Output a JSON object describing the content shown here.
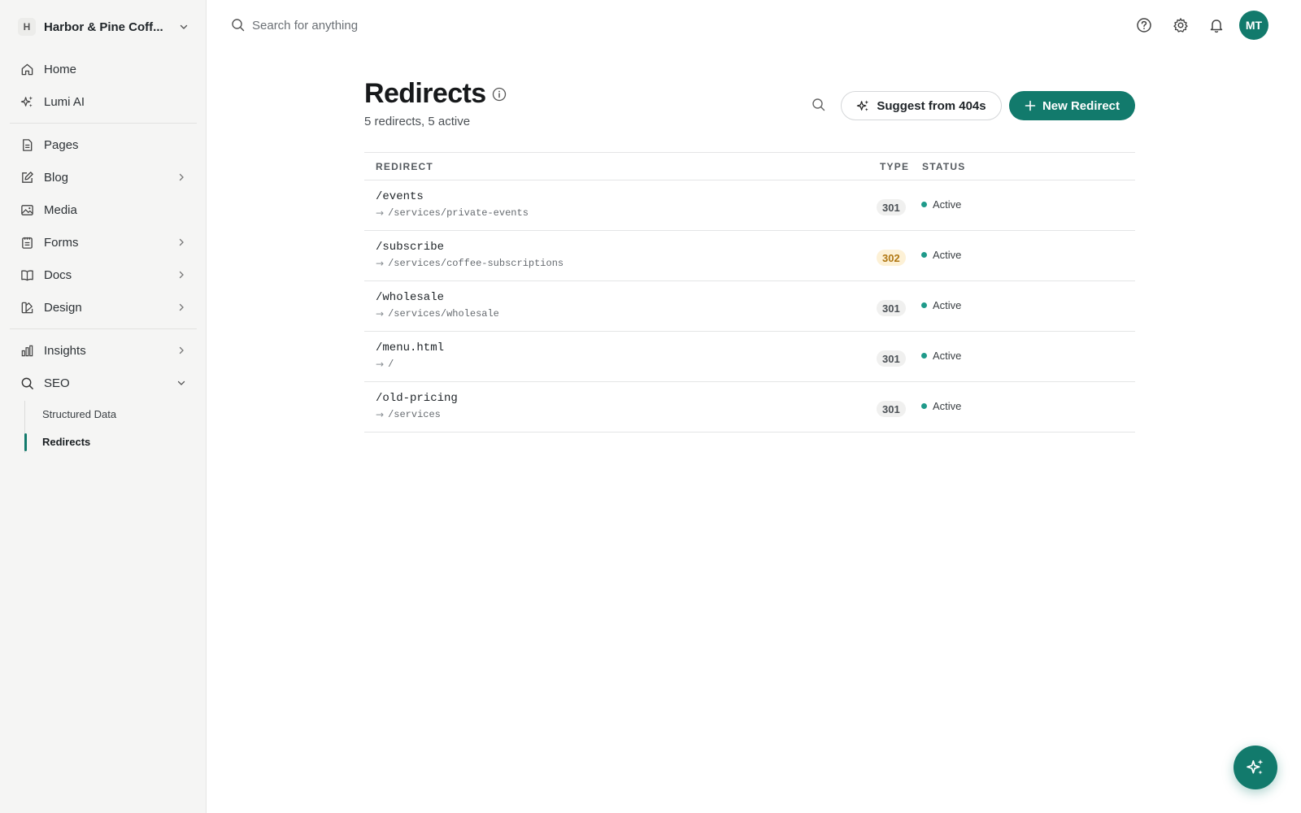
{
  "workspace": {
    "badge": "H",
    "name": "Harbor & Pine Coff..."
  },
  "search": {
    "placeholder": "Search for anything"
  },
  "user": {
    "initials": "MT"
  },
  "sidebar": {
    "group1": [
      {
        "label": "Home",
        "icon": "home-icon"
      },
      {
        "label": "Lumi AI",
        "icon": "sparkle-icon"
      }
    ],
    "group2": [
      {
        "label": "Pages",
        "icon": "page-icon"
      },
      {
        "label": "Blog",
        "icon": "edit-icon",
        "has_children": true
      },
      {
        "label": "Media",
        "icon": "image-icon"
      },
      {
        "label": "Forms",
        "icon": "forms-icon",
        "has_children": true
      },
      {
        "label": "Docs",
        "icon": "book-icon",
        "has_children": true
      },
      {
        "label": "Design",
        "icon": "design-icon",
        "has_children": true
      }
    ],
    "group3": [
      {
        "label": "Insights",
        "icon": "bar-chart-icon",
        "has_children": true
      },
      {
        "label": "SEO",
        "icon": "search-icon",
        "expanded": true
      }
    ],
    "seo_children": [
      {
        "label": "Structured Data"
      },
      {
        "label": "Redirects",
        "active": true
      }
    ]
  },
  "page": {
    "title": "Redirects",
    "subtitle": "5 redirects, 5 active",
    "suggest_label": "Suggest from 404s",
    "new_label": "New Redirect"
  },
  "table": {
    "columns": [
      "REDIRECT",
      "TYPE",
      "STATUS"
    ],
    "rows": [
      {
        "source": "/events",
        "destination": "/services/private-events",
        "type": "301",
        "status": "Active"
      },
      {
        "source": "/subscribe",
        "destination": "/services/coffee-subscriptions",
        "type": "302",
        "status": "Active"
      },
      {
        "source": "/wholesale",
        "destination": "/services/wholesale",
        "type": "301",
        "status": "Active"
      },
      {
        "source": "/menu.html",
        "destination": "/",
        "type": "301",
        "status": "Active"
      },
      {
        "source": "/old-pricing",
        "destination": "/services",
        "type": "301",
        "status": "Active"
      }
    ],
    "arrow": "→"
  },
  "colors": {
    "accent": "#127a6c",
    "status_active": "#1f9a8a",
    "badge_301_bg": "#f0f0ef",
    "badge_301_fg": "#4b5055",
    "badge_302_bg": "#fdf1d6",
    "badge_302_fg": "#b07712"
  }
}
